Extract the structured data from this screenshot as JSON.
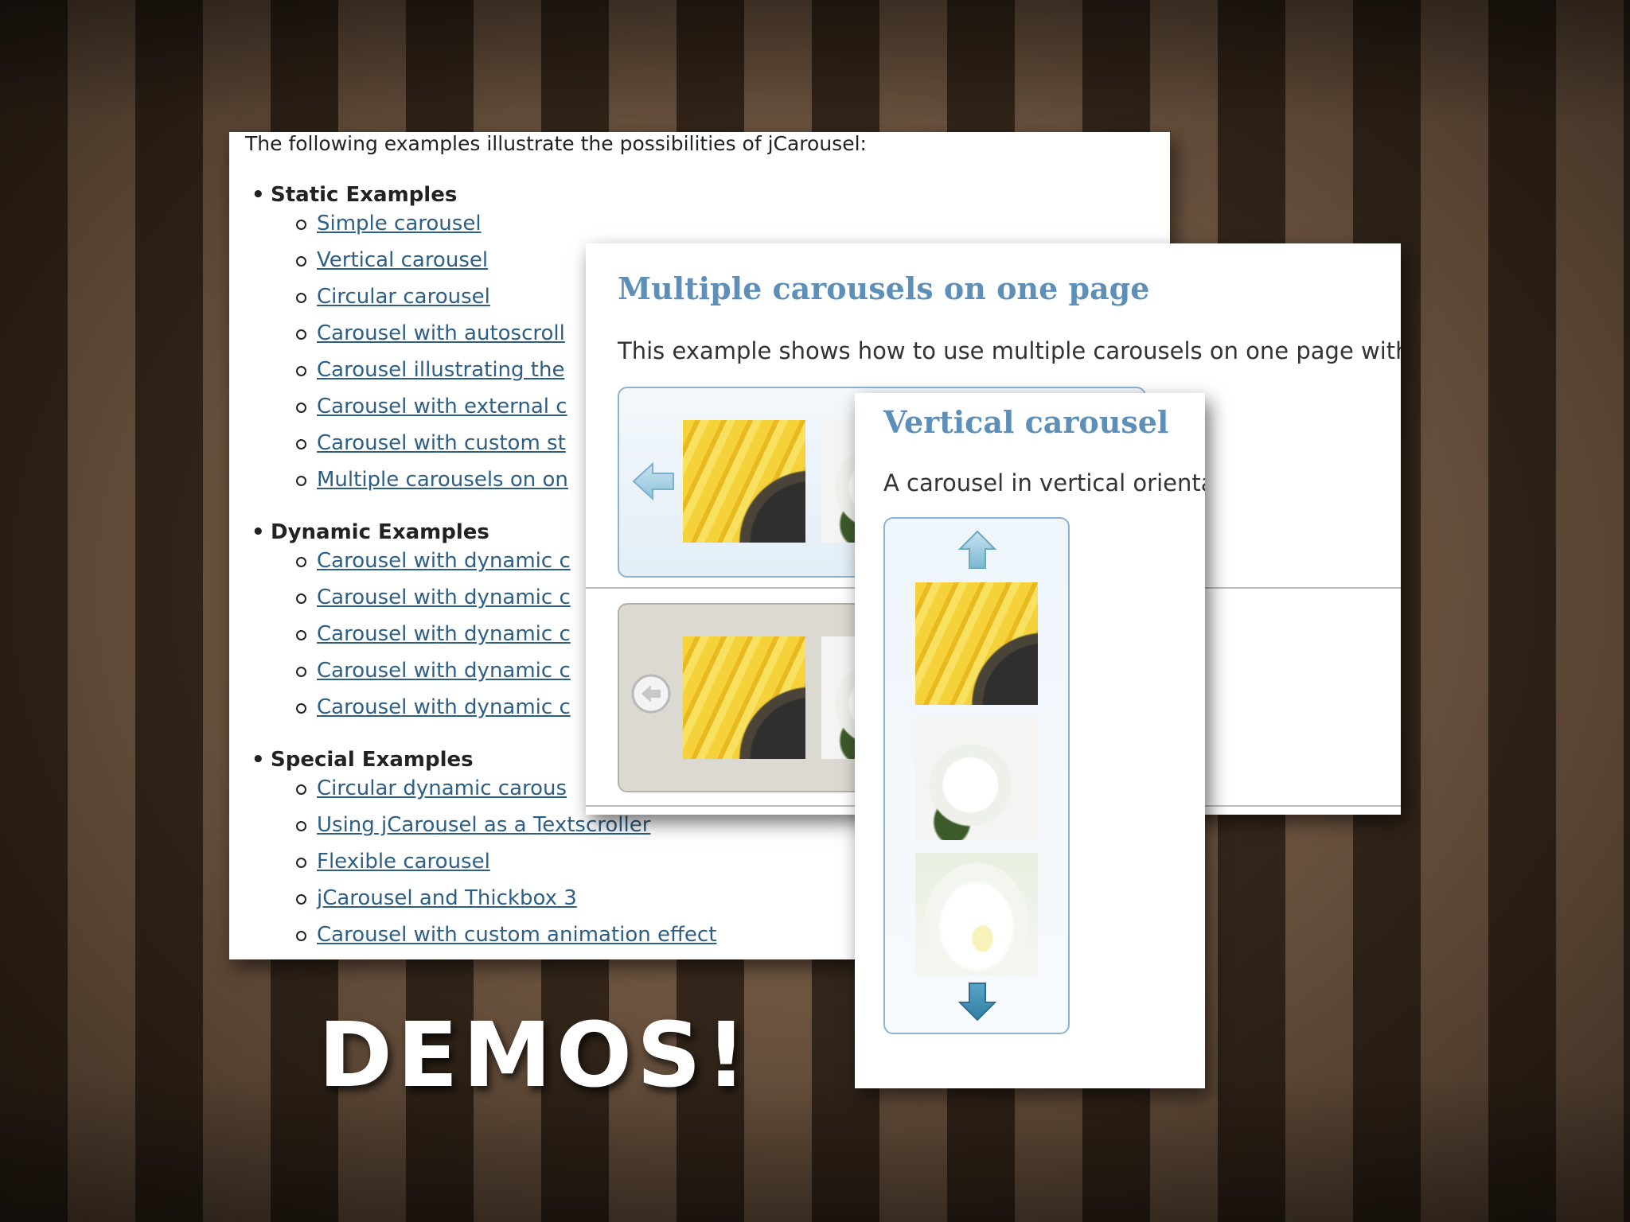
{
  "examples_page": {
    "intro": "The following examples illustrate the possibilities of jCarousel:",
    "groups": [
      {
        "heading": "Static Examples",
        "links": [
          "Simple carousel",
          "Vertical carousel",
          "Circular carousel",
          "Carousel with autoscroll",
          "Carousel illustrating the",
          "Carousel with external c",
          "Carousel with custom st",
          "Multiple carousels on on"
        ]
      },
      {
        "heading": "Dynamic Examples",
        "links": [
          "Carousel with dynamic c",
          "Carousel with dynamic c",
          "Carousel with dynamic c",
          "Carousel with dynamic c",
          "Carousel with dynamic c"
        ]
      },
      {
        "heading": "Special Examples",
        "links": [
          "Circular dynamic carous",
          "Using jCarousel as a Textscroller",
          "Flexible carousel",
          "jCarousel and Thickbox 3",
          "Carousel with custom animation effect"
        ]
      }
    ]
  },
  "multiple_page": {
    "title": "Multiple carousels on one page",
    "description": "This example shows how to use multiple carousels on one page with"
  },
  "vertical_page": {
    "title": "Vertical carousel",
    "description": "A carousel in vertical orienta"
  },
  "slide": {
    "title": "DEMOS!"
  },
  "colors": {
    "link": "#2d5f86",
    "heading_blue": "#5d8fb8",
    "stripe_dark": "#34261a",
    "stripe_light": "#6e5540"
  },
  "icons": {
    "prev_arrow_blue": "left-arrow-icon",
    "prev_arrow_grey": "circle-left-arrow-icon",
    "up_arrow": "up-arrow-icon",
    "down_arrow": "down-arrow-icon"
  }
}
